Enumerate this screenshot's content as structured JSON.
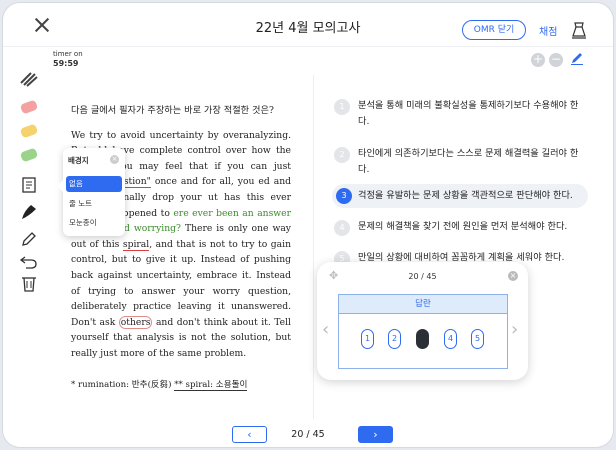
{
  "header": {
    "title": "22년 4월 모의고사",
    "omr_toggle_label": "OMR 닫기",
    "grade_label": "채점"
  },
  "timer": {
    "label": "timer on",
    "value": "59:59"
  },
  "zoom": {
    "plus": "+",
    "minus": "−"
  },
  "tools": {
    "highlight_colors": [
      "#444444",
      "#f08a8a",
      "#f5d26b",
      "#9ad48a"
    ],
    "icons": [
      "hatch-icon",
      "red-highlighter-icon",
      "yellow-highlighter-icon",
      "green-highlighter-icon",
      "background-icon",
      "brush-icon",
      "pencil-icon",
      "undo-icon",
      "trash-icon"
    ]
  },
  "passage": {
    "question": "다음 글에서 필자가 주장하는 바로 가장 적절한 것은?",
    "segments": {
      "s1": "We try to avoid uncertainty by overanalyzing. But ",
      "s2": "uld have complete control over how the future ",
      "s3": ". You may feel that if you can just ",
      "s4": "\"worry question\"",
      "s5": " once and for all, you ",
      "s6": "ed and you can finally drop your ",
      "s7": "ut has this ever actually happened to ",
      "s8": "ere ever been an answer that allowed ",
      "s9": "worrying?",
      "s10": " There is only one way out of this ",
      "s11": "spiral",
      "s12": ", and that is not to try to gain control, but to give it up. Instead of pushing back against uncertainty, embrace it. Instead of trying to answer your worry question, deliberately practice leaving it unanswered. Don't ask ",
      "s13": "others",
      "s14": " and don't think about it. Tell yourself that analysis is not the solution, but really just more of the same problem."
    },
    "footnote_a": "* rumination: 반추(反芻) ",
    "footnote_b": "** spiral: 소용돌이"
  },
  "background_popup": {
    "title": "배경지",
    "options": [
      "없음",
      "줄 노트",
      "모눈종이"
    ],
    "selected": "없음"
  },
  "choices": [
    {
      "num": "1",
      "text": "분석을 통해 미래의 불확실성을 통제하기보다 수용해야 한다."
    },
    {
      "num": "2",
      "text": "타인에게 의존하기보다는 스스로 문제 해결력을 길러야 한다."
    },
    {
      "num": "3",
      "text": "걱정을 유발하는 문제 상황을 객관적으로 판단해야 한다."
    },
    {
      "num": "4",
      "text": "문제의 해결책을 찾기 전에 원인을 먼저 분석해야 한다."
    },
    {
      "num": "5",
      "text": "만일의 상황에 대비하여 꼼꼼하게 계획을 세워야 한다."
    }
  ],
  "selected_choice": "3",
  "omr": {
    "page": "20 / 45",
    "header": "답란",
    "bubbles": [
      "1",
      "2",
      "3",
      "4",
      "5"
    ],
    "marked": "3"
  },
  "pager": {
    "prev": "‹",
    "next": "›",
    "page": "20 / 45"
  },
  "colors": {
    "accent": "#2f6bf0",
    "selected_bg": "#eef1f6"
  }
}
